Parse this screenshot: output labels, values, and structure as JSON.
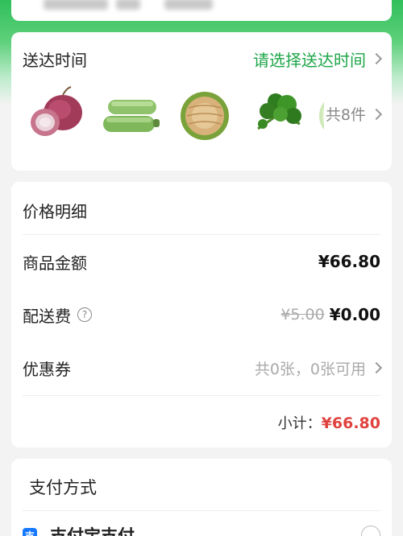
{
  "delivery": {
    "title": "送达时间",
    "select_label": "请选择送达时间",
    "items": [
      {
        "name": "onion-image"
      },
      {
        "name": "zucchini-image"
      },
      {
        "name": "noodles-image"
      },
      {
        "name": "leafy-greens-image"
      },
      {
        "name": "cabbage-image"
      }
    ],
    "count_label": "共8件"
  },
  "price": {
    "title": "价格明细",
    "goods_label": "商品金额",
    "goods_value": "¥66.80",
    "shipping_label": "配送费",
    "shipping_help": "?",
    "shipping_original": "¥5.00",
    "shipping_value": "¥0.00",
    "coupon_label": "优惠券",
    "coupon_value": "共0张，0张可用",
    "subtotal_label": "小计：",
    "subtotal_value": "¥66.80"
  },
  "payment": {
    "title": "支付方式",
    "method_icon": "支",
    "method_name": "支付宝支付"
  },
  "colors": {
    "accent_green": "#1fa64a",
    "price_red": "#e0433e",
    "alipay_blue": "#1678ff"
  }
}
